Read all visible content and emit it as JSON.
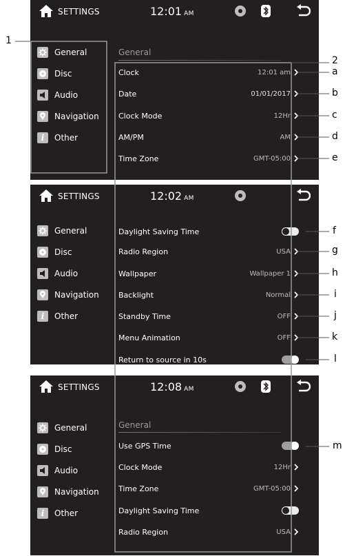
{
  "header": {
    "title": "SETTINGS"
  },
  "panel1": {
    "time": "12:01",
    "ampm": "AM",
    "sidebar": [
      "General",
      "Disc",
      "Audio",
      "Navigation",
      "Other"
    ],
    "section": "General",
    "rows": [
      {
        "label": "Clock",
        "value": "12:01 am"
      },
      {
        "label": "Date",
        "value": "01/01/2017"
      },
      {
        "label": "Clock Mode",
        "value": "12Hr"
      },
      {
        "label": "AM/PM",
        "value": "AM"
      },
      {
        "label": "Time Zone",
        "value": "GMT-05:00"
      }
    ]
  },
  "panel2": {
    "time": "12:02",
    "ampm": "AM",
    "sidebar": [
      "General",
      "Disc",
      "Audio",
      "Navigation",
      "Other"
    ],
    "rows": [
      {
        "label": "Daylight Saving Time",
        "toggle": "off"
      },
      {
        "label": "Radio Region",
        "value": "USA"
      },
      {
        "label": "Wallpaper",
        "value": "Wallpaper 1"
      },
      {
        "label": "Backlight",
        "value": "Normal"
      },
      {
        "label": "Standby Time",
        "value": "OFF"
      },
      {
        "label": "Menu Animation",
        "value": "OFF"
      },
      {
        "label": "Return to source in 10s",
        "toggle": "on"
      }
    ]
  },
  "panel3": {
    "time": "12:08",
    "ampm": "AM",
    "sidebar": [
      "General",
      "Disc",
      "Audio",
      "Navigation",
      "Other"
    ],
    "section": "General",
    "rows": [
      {
        "label": "Use GPS Time",
        "toggle": "on"
      },
      {
        "label": "Clock Mode",
        "value": "12Hr"
      },
      {
        "label": "Time Zone",
        "value": "GMT-05:00"
      },
      {
        "label": "Daylight Saving Time",
        "toggle": "off"
      },
      {
        "label": "Radio Region",
        "value": "USA"
      }
    ]
  },
  "callouts": [
    "1",
    "2",
    "a",
    "b",
    "c",
    "d",
    "e",
    "f",
    "g",
    "h",
    "i",
    "j",
    "k",
    "l",
    "m"
  ]
}
